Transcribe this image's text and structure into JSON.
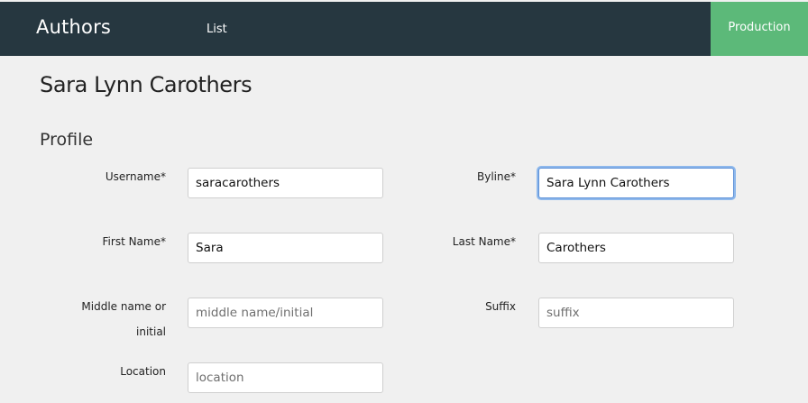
{
  "header": {
    "brand": "Authors",
    "nav_list": "List",
    "environment": "Production"
  },
  "page": {
    "title": "Sara Lynn Carothers",
    "section": "Profile"
  },
  "form": {
    "username": {
      "label": "Username*",
      "value": "saracarothers",
      "placeholder": ""
    },
    "byline": {
      "label": "Byline*",
      "value": "Sara Lynn Carothers",
      "placeholder": ""
    },
    "first_name": {
      "label": "First Name*",
      "value": "Sara",
      "placeholder": ""
    },
    "last_name": {
      "label": "Last Name*",
      "value": "Carothers",
      "placeholder": ""
    },
    "middle_name": {
      "label_line1": "Middle name or",
      "label_line2": "initial",
      "value": "",
      "placeholder": "middle name/initial"
    },
    "suffix": {
      "label": "Suffix",
      "value": "",
      "placeholder": "suffix"
    },
    "location": {
      "label": "Location",
      "value": "",
      "placeholder": "location"
    }
  }
}
